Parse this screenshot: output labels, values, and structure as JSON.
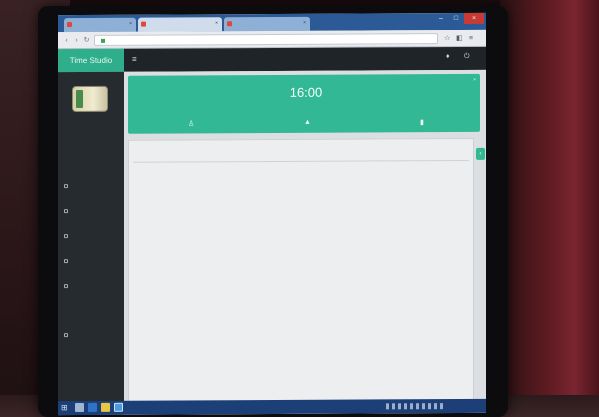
{
  "scene": {
    "description_colors": {
      "brand_green": "#2fae8c",
      "hero_green": "#33b896",
      "sidebar_bg": "#262b30",
      "topnav_bg": "#1f2428",
      "taskbar_bg": "#1c3f78",
      "tab_bar_bg": "#2b5a96"
    }
  },
  "browser": {
    "tabs": [
      "",
      "",
      ""
    ],
    "url": ""
  },
  "app": {
    "brand": "Time Studio"
  },
  "hero": {
    "clock": "16:00"
  },
  "icons": {
    "hamburger": "menu-icon",
    "bell": "bell-icon",
    "power": "power-icon",
    "hero_left": "person-icon",
    "hero_center": "drop-icon",
    "hero_right": "trash-icon",
    "start": "windows-start-icon"
  }
}
